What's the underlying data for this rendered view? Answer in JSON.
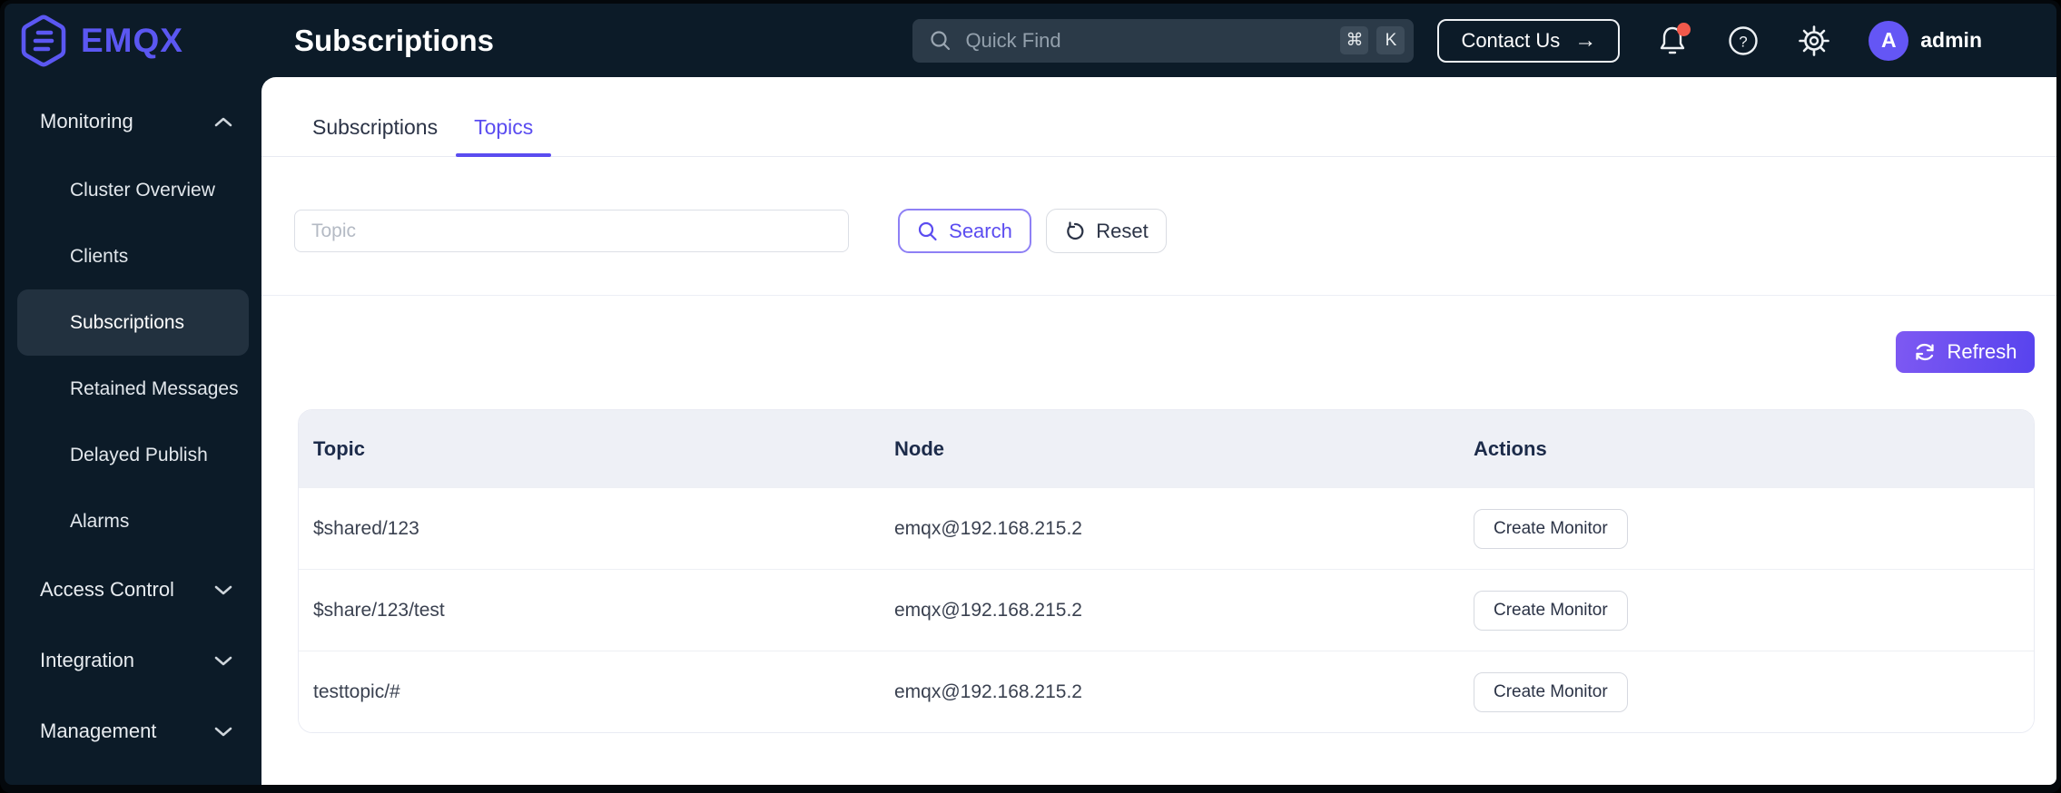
{
  "header": {
    "logo_text": "EMQX",
    "page_title": "Subscriptions",
    "quick_find_placeholder": "Quick Find",
    "shortcut_keys": [
      "⌘",
      "K"
    ],
    "contact_us_label": "Contact Us",
    "contact_us_arrow": "→",
    "avatar_letter": "A",
    "user_name": "admin"
  },
  "sidebar": {
    "groups": [
      {
        "label": "Monitoring",
        "state": "expanded",
        "items": [
          {
            "label": "Cluster Overview"
          },
          {
            "label": "Clients"
          },
          {
            "label": "Subscriptions",
            "active": true
          },
          {
            "label": "Retained Messages"
          },
          {
            "label": "Delayed Publish"
          },
          {
            "label": "Alarms"
          }
        ]
      },
      {
        "label": "Access Control",
        "state": "collapsed"
      },
      {
        "label": "Integration",
        "state": "collapsed"
      },
      {
        "label": "Management",
        "state": "collapsed"
      }
    ]
  },
  "tabs": [
    {
      "label": "Subscriptions",
      "active": false
    },
    {
      "label": "Topics",
      "active": true
    }
  ],
  "filter": {
    "topic_placeholder": "Topic",
    "topic_value": "",
    "search_label": "Search",
    "reset_label": "Reset"
  },
  "toolbar": {
    "refresh_label": "Refresh"
  },
  "table": {
    "columns": [
      "Topic",
      "Node",
      "Actions"
    ],
    "rows": [
      {
        "topic": "$shared/123",
        "node": "emqx@192.168.215.2",
        "action": "Create Monitor"
      },
      {
        "topic": "$share/123/test",
        "node": "emqx@192.168.215.2",
        "action": "Create Monitor"
      },
      {
        "topic": "testtopic/#",
        "node": "emqx@192.168.215.2",
        "action": "Create Monitor"
      }
    ]
  },
  "colors": {
    "accent_purple": "#5b4cf0",
    "logo_purple": "#5b57f2",
    "refresh_gradient_start": "#7e59f2",
    "refresh_gradient_end": "#5743ee",
    "dark_navy_bg": "#0c1b28",
    "sidebar_active_bg": "#22313f",
    "quickfind_bg": "#2b3a48",
    "table_header_bg": "#eef0f6",
    "notification_dot": "#f2594b",
    "avatar_bg": "#6456f5"
  }
}
